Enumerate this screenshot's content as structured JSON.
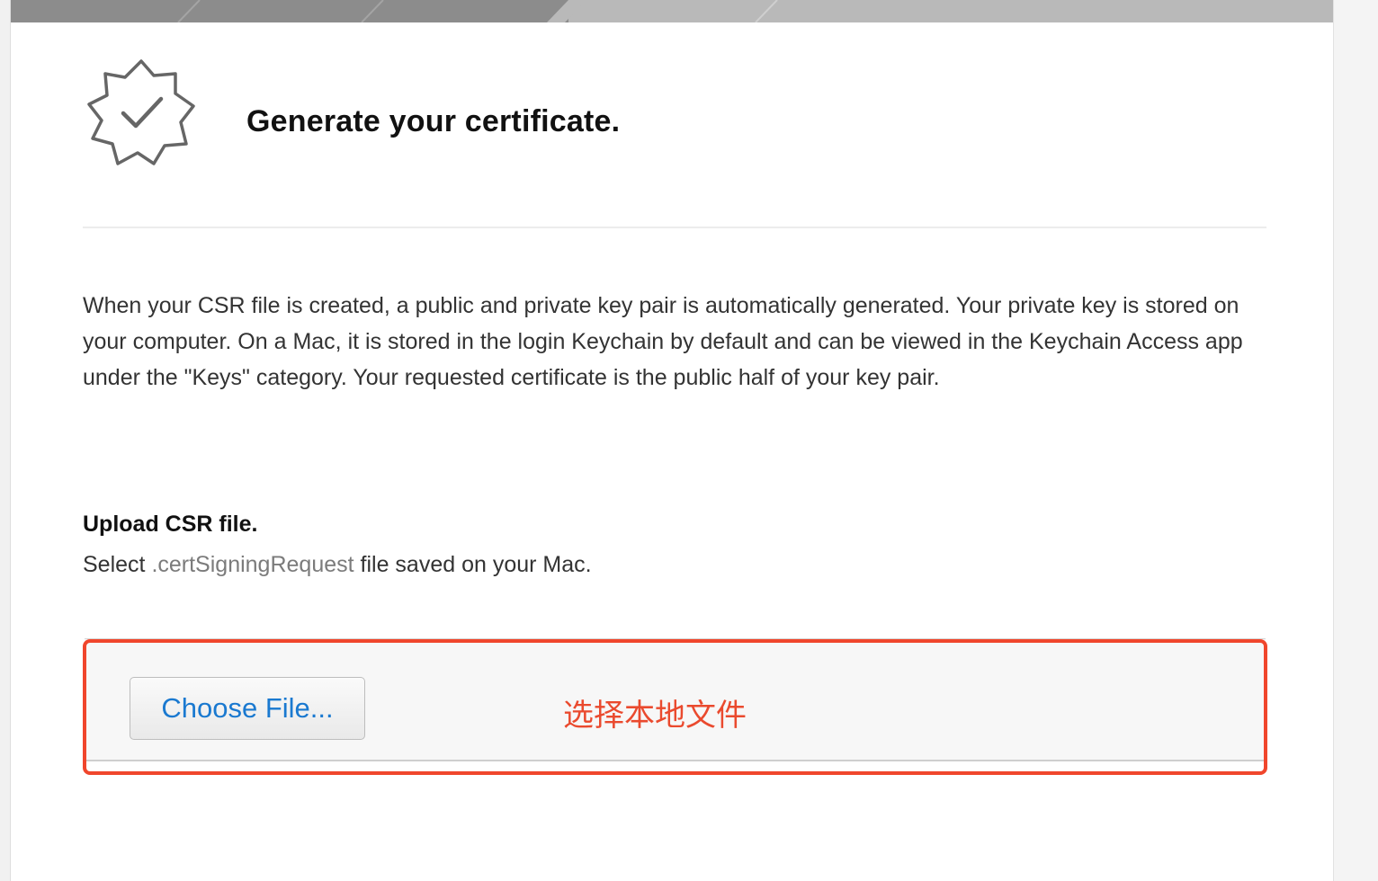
{
  "header": {
    "title": "Generate your certificate.",
    "icon": "certificate-badge-icon"
  },
  "description": "When your CSR file is created, a public and private key pair is automatically generated. Your private key is stored on your computer. On a Mac, it is stored in the login Keychain by default and can be viewed in the Keychain Access app under the \"Keys\" category. Your requested certificate is the public half of your key pair.",
  "upload": {
    "heading": "Upload CSR file.",
    "instruction_prefix": "Select",
    "instruction_extension": ".certSigningRequest",
    "instruction_suffix": "file saved on your Mac.",
    "choose_button_label": "Choose File..."
  },
  "annotation": {
    "label": "选择本地文件",
    "color": "#ea4a2e"
  },
  "colors": {
    "button_text": "#1a79d0",
    "annotation_border": "#f0462c"
  }
}
